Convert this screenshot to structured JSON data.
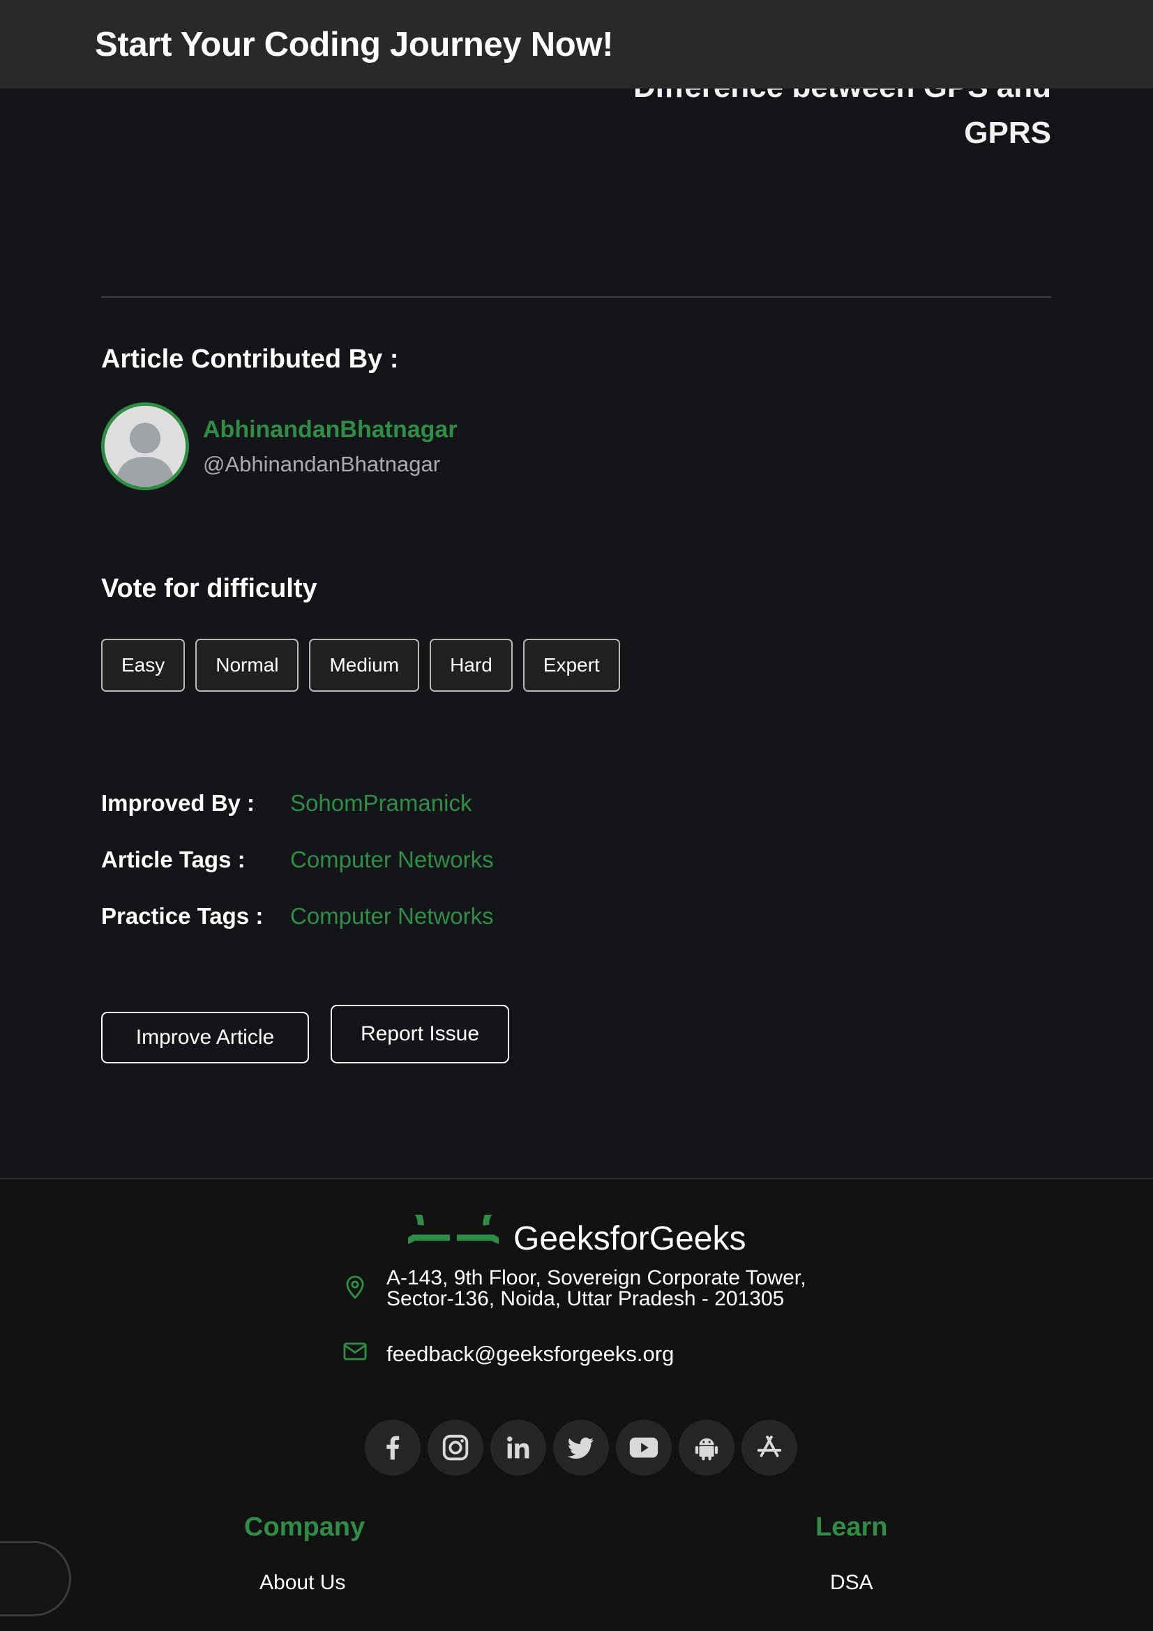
{
  "banner": {
    "text": "Start Your Coding Journey Now!"
  },
  "prev_article": {
    "title": "Difference between GPS and GPRS"
  },
  "contributor": {
    "heading": "Article Contributed By :",
    "name": "AbhinandanBhatnagar",
    "handle": "@AbhinandanBhatnagar"
  },
  "difficulty": {
    "heading": "Vote for difficulty",
    "options": [
      "Easy",
      "Normal",
      "Medium",
      "Hard",
      "Expert"
    ]
  },
  "meta": {
    "improved_by_label": "Improved By :",
    "improved_by_value": "SohomPramanick",
    "article_tags_label": "Article Tags :",
    "article_tags_value": "Computer Networks",
    "practice_tags_label": "Practice Tags :",
    "practice_tags_value": "Computer Networks"
  },
  "actions": {
    "improve_label": "Improve Article",
    "report_label": "Report Issue"
  },
  "footer": {
    "brand": "GeeksforGeeks",
    "address_line1": "A-143, 9th Floor, Sovereign Corporate Tower,",
    "address_line2": "Sector-136, Noida, Uttar Pradesh - 201305",
    "email": "feedback@geeksforgeeks.org",
    "social_icons": [
      "facebook-icon",
      "instagram-icon",
      "linkedin-icon",
      "twitter-icon",
      "youtube-icon",
      "android-icon",
      "app-store-icon"
    ],
    "columns": [
      {
        "title": "Company",
        "links": [
          "About Us"
        ]
      },
      {
        "title": "Learn",
        "links": [
          "DSA"
        ]
      }
    ]
  },
  "colors": {
    "accent": "#2f8d46",
    "background": "#131519",
    "banner": "#28292b",
    "footer": "#121212"
  }
}
